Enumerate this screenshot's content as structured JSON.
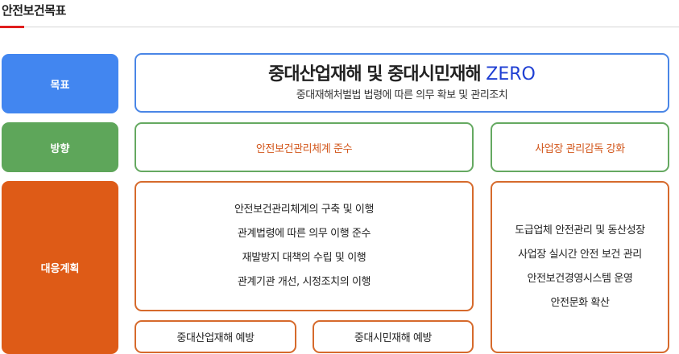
{
  "page": {
    "title": "안전보건목표"
  },
  "labels": {
    "goal": "목표",
    "direction": "방향",
    "plan": "대응계획"
  },
  "goal": {
    "main_text": "중대산업재해 및 중대시민재해",
    "main_highlight": "ZERO",
    "sub_text": "중대재해처벌법 법령에 따른 의무 확보 및 관리조치"
  },
  "directions": [
    "안전보건관리체계 준수",
    "사업장 관리감독 강화"
  ],
  "plans_left": [
    "안전보건관리체계의 구축 및 이행",
    "관계법령에 따른 의무 이행 준수",
    "재발방지 대책의 수립 및 이행",
    "관계기관 개선, 시정조치의 이행"
  ],
  "plans_right": [
    "도급업체 안전관리 및 동산성장",
    "사업장 실시간 안전 보건 관리",
    "안전보건경영시스템 운영",
    "안전문화 확산"
  ],
  "prevention": [
    "중대산업재해 예방",
    "중대시민재해 예방"
  ],
  "colors": {
    "goal": "#4286f0",
    "direction": "#5ea65a",
    "plan": "#de5b17",
    "accent": "#e01e1e",
    "zero": "#1f3fd3"
  }
}
